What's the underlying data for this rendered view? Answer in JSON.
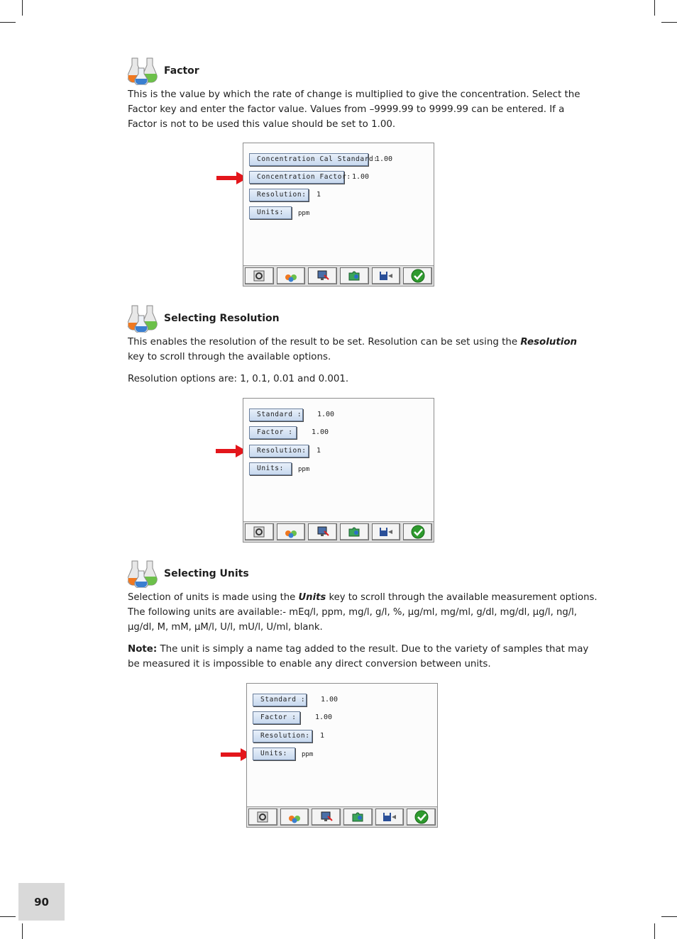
{
  "sections": [
    {
      "title": "Factor",
      "icon": "flask-icon",
      "paragraphs": [
        "This is the value by which the rate of change is multiplied to give the concentration. Select the Factor key and enter the factor value. Values from –9999.99 to 9999.99 can be entered. If a Factor is not to be used this value should be set to 1.00."
      ],
      "screen": {
        "fields": [
          {
            "label": "Concentration Cal Standard:",
            "value": "1.00"
          },
          {
            "label": "Concentration Factor:",
            "value": "1.00"
          },
          {
            "label": "Resolution:",
            "value": "1"
          },
          {
            "label": "Units:",
            "value": "ppm"
          }
        ],
        "arrow_target": "Concentration Factor:"
      }
    },
    {
      "title": "Selecting Resolution",
      "icon": "flask-icon",
      "paragraphs": [
        {
          "pre": "This enables the resolution of the result to be set. Resolution can be set using the ",
          "em": "Resolution",
          "post": " key to scroll through the available options."
        },
        "Resolution options are: 1, 0.1, 0.01 and 0.001."
      ],
      "screen": {
        "fields": [
          {
            "label": "Standard :",
            "value": "1.00"
          },
          {
            "label": "Factor :",
            "value": "1.00"
          },
          {
            "label": "Resolution:",
            "value": "1"
          },
          {
            "label": "Units:",
            "value": "ppm"
          }
        ],
        "arrow_target": "Resolution:"
      }
    },
    {
      "title": "Selecting Units",
      "icon": "flask-icon",
      "paragraphs": [
        {
          "pre": "Selection of units is made using the ",
          "em": "Units",
          "post": " key to scroll through the available measurement options. The following units are available:- mEq/l, ppm, mg/l, g/l, %, µg/ml, mg/ml, g/dl, mg/dl, µg/l, ng/l, µg/dl, M, mM, µM/l, U/l, mU/l, U/ml, blank."
        },
        {
          "strong": "Note:",
          "post": " The unit is simply a name tag added to the result. Due to the variety of samples that may be measured it is impossible to enable any direct conversion between units."
        }
      ],
      "screen": {
        "fields": [
          {
            "label": "Standard :",
            "value": "1.00"
          },
          {
            "label": "Factor :",
            "value": "1.00"
          },
          {
            "label": "Resolution:",
            "value": "1"
          },
          {
            "label": "Units:",
            "value": "ppm"
          }
        ],
        "arrow_target": "Units:"
      }
    }
  ],
  "toolbar_icons": [
    "tools-icon",
    "flask-icon",
    "monitor-icon",
    "gear-puzzle-icon",
    "save-icon",
    "confirm-check-icon"
  ],
  "page_number": "90",
  "colors": {
    "arrow": "#e3161b",
    "page_tab": "#d9d9d9",
    "softkey": "#c7d8ee",
    "check": "#2e9a2e"
  }
}
